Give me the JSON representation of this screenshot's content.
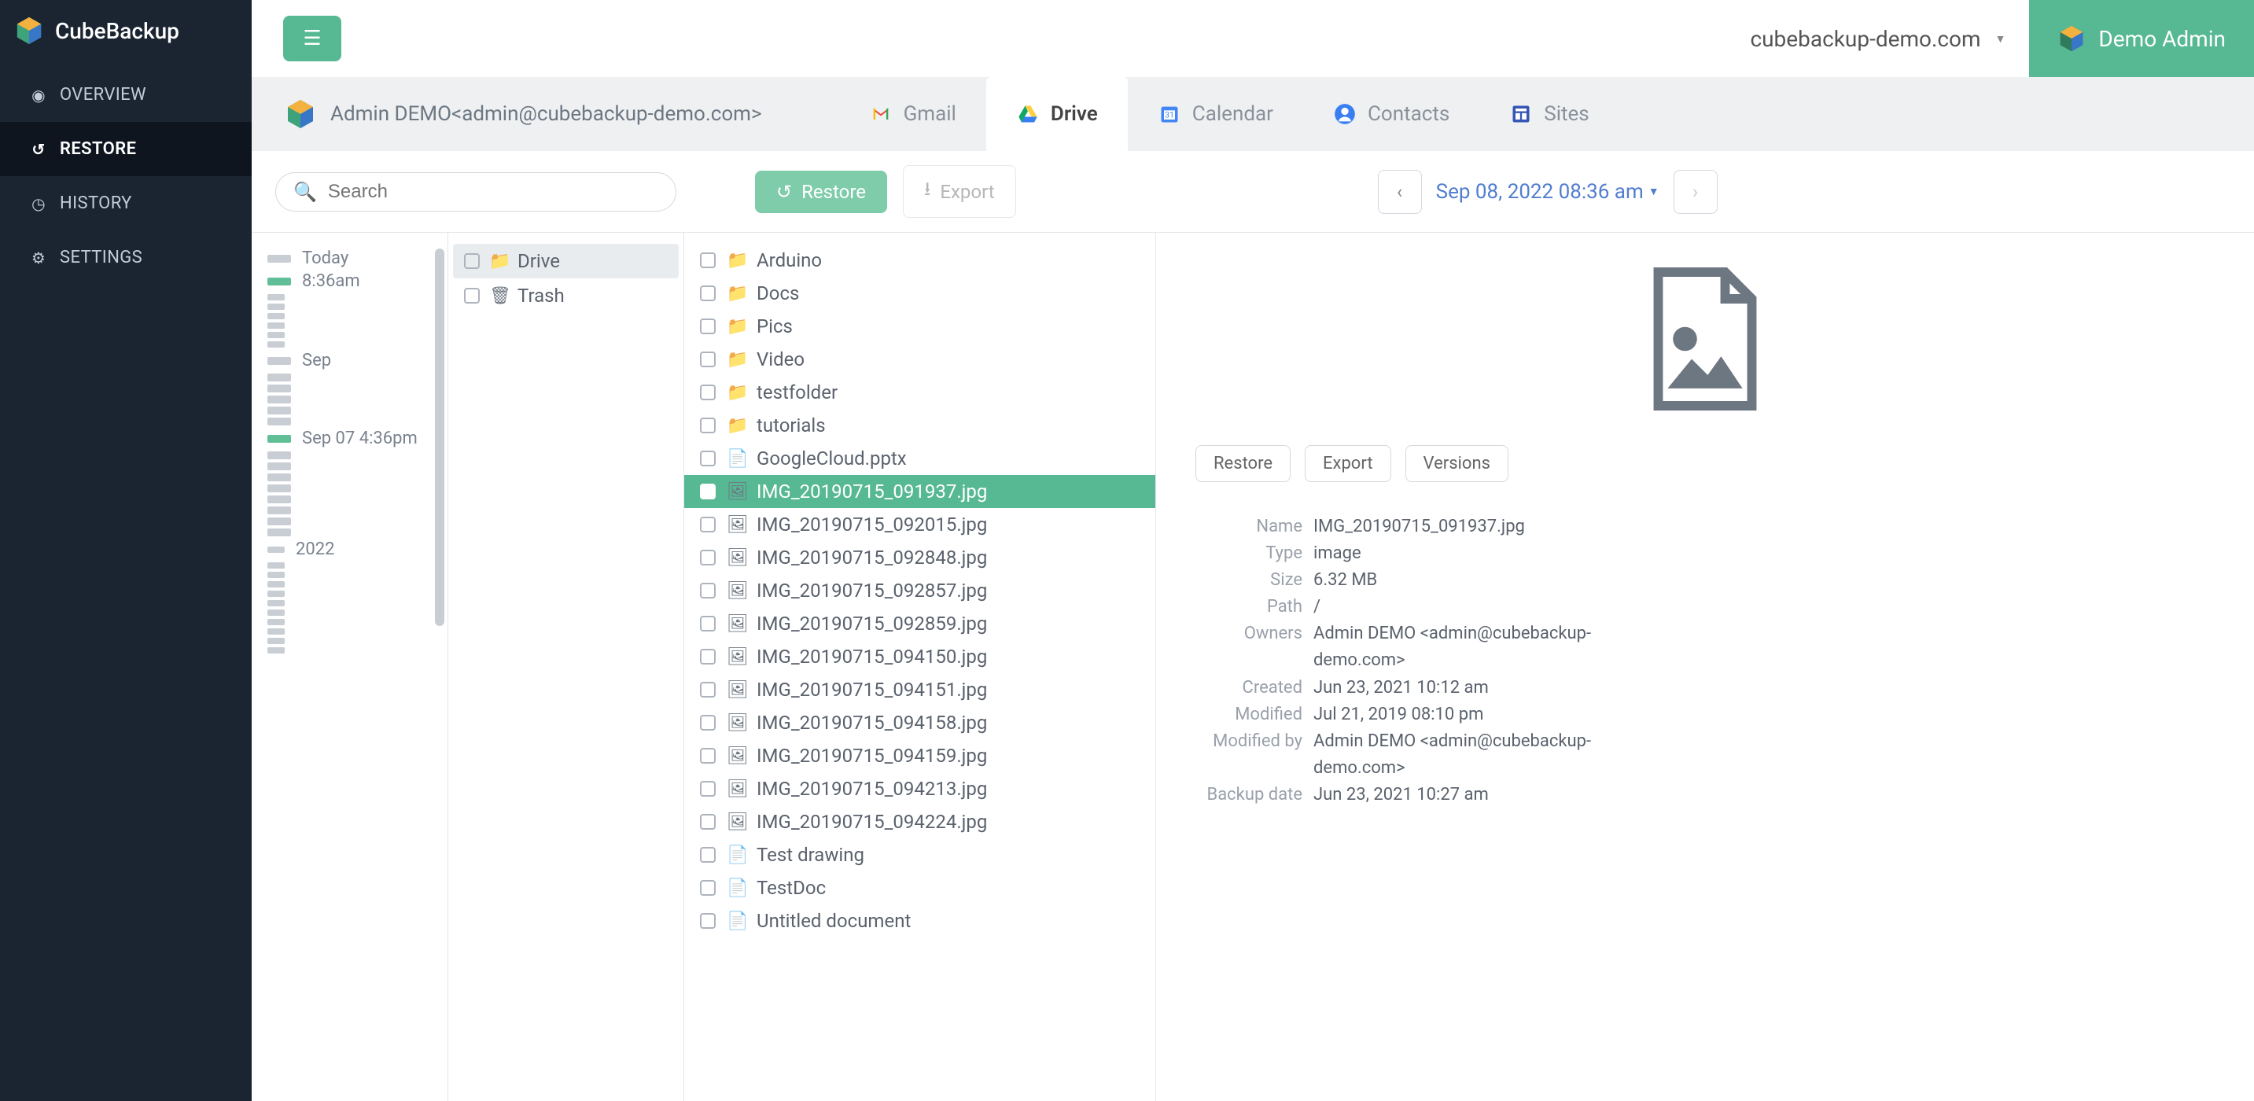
{
  "brand": "CubeBackup",
  "nav": {
    "overview": "OVERVIEW",
    "restore": "RESTORE",
    "history": "HISTORY",
    "settings": "SETTINGS"
  },
  "topbar": {
    "domain": "cubebackup-demo.com",
    "user": "Demo Admin"
  },
  "subheader": {
    "user": "Admin DEMO<admin@cubebackup-demo.com>",
    "tabs": {
      "gmail": "Gmail",
      "drive": "Drive",
      "calendar": "Calendar",
      "contacts": "Contacts",
      "sites": "Sites"
    }
  },
  "toolbar": {
    "search_placeholder": "Search",
    "restore": "Restore",
    "export": "Export",
    "datetime": "Sep 08, 2022 08:36 am"
  },
  "timeline": {
    "today": "Today",
    "time": "8:36am",
    "sep_label": "Sep",
    "sep07": "Sep 07 4:36pm",
    "year": "2022"
  },
  "tree": {
    "drive": "Drive",
    "trash": "Trash"
  },
  "files": [
    {
      "name": "Arduino",
      "type": "folder"
    },
    {
      "name": "Docs",
      "type": "folder"
    },
    {
      "name": "Pics",
      "type": "folder"
    },
    {
      "name": "Video",
      "type": "folder"
    },
    {
      "name": "testfolder",
      "type": "folder"
    },
    {
      "name": "tutorials",
      "type": "folder"
    },
    {
      "name": "GoogleCloud.pptx",
      "type": "doc"
    },
    {
      "name": "IMG_20190715_091937.jpg",
      "type": "image",
      "selected": true
    },
    {
      "name": "IMG_20190715_092015.jpg",
      "type": "image"
    },
    {
      "name": "IMG_20190715_092848.jpg",
      "type": "image"
    },
    {
      "name": "IMG_20190715_092857.jpg",
      "type": "image"
    },
    {
      "name": "IMG_20190715_092859.jpg",
      "type": "image"
    },
    {
      "name": "IMG_20190715_094150.jpg",
      "type": "image"
    },
    {
      "name": "IMG_20190715_094151.jpg",
      "type": "image"
    },
    {
      "name": "IMG_20190715_094158.jpg",
      "type": "image"
    },
    {
      "name": "IMG_20190715_094159.jpg",
      "type": "image"
    },
    {
      "name": "IMG_20190715_094213.jpg",
      "type": "image"
    },
    {
      "name": "IMG_20190715_094224.jpg",
      "type": "image"
    },
    {
      "name": "Test drawing",
      "type": "doc"
    },
    {
      "name": "TestDoc",
      "type": "doc"
    },
    {
      "name": "Untitled document",
      "type": "doc"
    }
  ],
  "details": {
    "actions": {
      "restore": "Restore",
      "export": "Export",
      "versions": "Versions"
    },
    "labels": {
      "name": "Name",
      "type": "Type",
      "size": "Size",
      "path": "Path",
      "owners": "Owners",
      "created": "Created",
      "modified": "Modified",
      "modified_by": "Modified by",
      "backup_date": "Backup date"
    },
    "values": {
      "name": "IMG_20190715_091937.jpg",
      "type": "image",
      "size": "6.32 MB",
      "path": "/",
      "owners": "Admin DEMO <admin@cubebackup-demo.com>",
      "created": "Jun 23, 2021 10:12 am",
      "modified": "Jul 21, 2019 08:10 pm",
      "modified_by": "Admin DEMO <admin@cubebackup-demo.com>",
      "backup_date": "Jun 23, 2021 10:27 am"
    }
  }
}
